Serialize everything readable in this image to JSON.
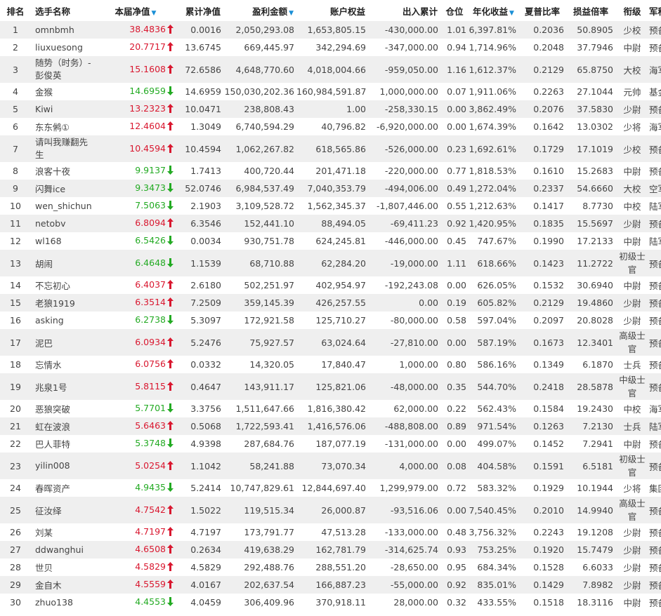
{
  "headers": {
    "rank": "排名",
    "name": "选手名称",
    "nav": "本届净值",
    "cum_nav": "累计净值",
    "pnl": "盈利金额",
    "equity": "账户权益",
    "inout": "出入累计",
    "position": "仓位",
    "annual": "年化收益",
    "sharpe": "夏普比率",
    "loss_ratio": "损益倍率",
    "title": "衔级",
    "branch": "军种"
  },
  "sort_icon": "caret-down-icon",
  "colors": {
    "up": "#d9172f",
    "down": "#22aa22",
    "sort": "#1a8fd6",
    "stripe": "#efefef"
  },
  "rows": [
    {
      "rank": "1",
      "name": "omnbmh",
      "nav": "38.4836",
      "dir": "up",
      "cum": "0.0016",
      "pnl": "2,050,293.08",
      "equity": "1,653,805.15",
      "inout": "-430,000.00",
      "pos": "1.01",
      "annual": "6,397.81%",
      "sharpe": "0.2036",
      "lr": "50.8905",
      "title": "少校",
      "branch": "预备役"
    },
    {
      "rank": "2",
      "name": "liuxuesong",
      "nav": "20.7717",
      "dir": "up",
      "cum": "13.6745",
      "pnl": "669,445.97",
      "equity": "342,294.69",
      "inout": "-347,000.00",
      "pos": "0.94",
      "annual": "1,714.96%",
      "sharpe": "0.2048",
      "lr": "37.7946",
      "title": "中尉",
      "branch": "预备役"
    },
    {
      "rank": "3",
      "name": "随势（时务）- 彭俊英",
      "nav": "15.1608",
      "dir": "up",
      "cum": "72.6586",
      "pnl": "4,648,770.60",
      "equity": "4,018,004.66",
      "inout": "-959,050.00",
      "pos": "1.16",
      "annual": "1,612.37%",
      "sharpe": "0.2129",
      "lr": "65.8750",
      "title": "大校",
      "branch": "海军",
      "tall": true
    },
    {
      "rank": "4",
      "name": "金猴",
      "nav": "14.6959",
      "dir": "down",
      "cum": "14.6959",
      "pnl": "150,030,202.36",
      "equity": "160,984,591.87",
      "inout": "1,000,000.00",
      "pos": "0.07",
      "annual": "1,911.06%",
      "sharpe": "0.2263",
      "lr": "27.1044",
      "title": "元帅",
      "branch": "基金"
    },
    {
      "rank": "5",
      "name": "Kiwi",
      "nav": "13.2323",
      "dir": "up",
      "cum": "10.0471",
      "pnl": "238,808.43",
      "equity": "1.00",
      "inout": "-258,330.15",
      "pos": "0.00",
      "annual": "3,862.49%",
      "sharpe": "0.2076",
      "lr": "37.5830",
      "title": "少尉",
      "branch": "预备役"
    },
    {
      "rank": "6",
      "name": "东东鸺①",
      "nav": "12.4604",
      "dir": "up",
      "cum": "1.3049",
      "pnl": "6,740,594.29",
      "equity": "40,796.82",
      "inout": "-6,920,000.00",
      "pos": "0.00",
      "annual": "1,674.39%",
      "sharpe": "0.1642",
      "lr": "13.0302",
      "title": "少将",
      "branch": "海军"
    },
    {
      "rank": "7",
      "name": "请叫我赚翻先生",
      "nav": "10.4594",
      "dir": "up",
      "cum": "10.4594",
      "pnl": "1,062,267.82",
      "equity": "618,565.86",
      "inout": "-526,000.00",
      "pos": "0.23",
      "annual": "1,692.61%",
      "sharpe": "0.1729",
      "lr": "17.1019",
      "title": "少校",
      "branch": "预备役",
      "tall": true
    },
    {
      "rank": "8",
      "name": "浪客十夜",
      "nav": "9.9137",
      "dir": "down",
      "cum": "1.7413",
      "pnl": "400,720.44",
      "equity": "201,471.18",
      "inout": "-220,000.00",
      "pos": "0.77",
      "annual": "1,818.53%",
      "sharpe": "0.1610",
      "lr": "15.2683",
      "title": "中尉",
      "branch": "预备役"
    },
    {
      "rank": "9",
      "name": "闪舞ice",
      "nav": "9.3473",
      "dir": "down",
      "cum": "52.0746",
      "pnl": "6,984,537.49",
      "equity": "7,040,353.79",
      "inout": "-494,006.00",
      "pos": "0.49",
      "annual": "1,272.04%",
      "sharpe": "0.2337",
      "lr": "54.6660",
      "title": "大校",
      "branch": "空军"
    },
    {
      "rank": "10",
      "name": "wen_shichun",
      "nav": "7.5063",
      "dir": "down",
      "cum": "2.1903",
      "pnl": "3,109,528.72",
      "equity": "1,562,345.37",
      "inout": "-1,807,446.00",
      "pos": "0.55",
      "annual": "1,212.63%",
      "sharpe": "0.1417",
      "lr": "8.7730",
      "title": "中校",
      "branch": "陆军"
    },
    {
      "rank": "11",
      "name": "netobv",
      "nav": "6.8094",
      "dir": "up",
      "cum": "6.3546",
      "pnl": "152,441.10",
      "equity": "88,494.05",
      "inout": "-69,411.23",
      "pos": "0.92",
      "annual": "1,420.95%",
      "sharpe": "0.1835",
      "lr": "15.5697",
      "title": "少尉",
      "branch": "预备役"
    },
    {
      "rank": "12",
      "name": "wl168",
      "nav": "6.5426",
      "dir": "down",
      "cum": "0.0034",
      "pnl": "930,751.78",
      "equity": "624,245.81",
      "inout": "-446,000.00",
      "pos": "0.45",
      "annual": "747.67%",
      "sharpe": "0.1990",
      "lr": "17.2133",
      "title": "中尉",
      "branch": "陆军"
    },
    {
      "rank": "13",
      "name": "胡闹",
      "nav": "6.4648",
      "dir": "down",
      "cum": "1.1539",
      "pnl": "68,710.88",
      "equity": "62,284.20",
      "inout": "-19,000.00",
      "pos": "1.11",
      "annual": "618.66%",
      "sharpe": "0.1423",
      "lr": "11.2722",
      "title": "初级士官",
      "branch": "预备役",
      "tall": true
    },
    {
      "rank": "14",
      "name": "不忘初心",
      "nav": "6.4037",
      "dir": "up",
      "cum": "2.6180",
      "pnl": "502,251.97",
      "equity": "402,954.97",
      "inout": "-192,243.08",
      "pos": "0.00",
      "annual": "626.05%",
      "sharpe": "0.1532",
      "lr": "30.6940",
      "title": "中尉",
      "branch": "预备役"
    },
    {
      "rank": "15",
      "name": "老狼1919",
      "nav": "6.3514",
      "dir": "up",
      "cum": "7.2509",
      "pnl": "359,145.39",
      "equity": "426,257.55",
      "inout": "0.00",
      "pos": "0.19",
      "annual": "605.82%",
      "sharpe": "0.2129",
      "lr": "19.4860",
      "title": "少尉",
      "branch": "预备役"
    },
    {
      "rank": "16",
      "name": "asking",
      "nav": "6.2738",
      "dir": "down",
      "cum": "5.3097",
      "pnl": "172,921.58",
      "equity": "125,710.27",
      "inout": "-80,000.00",
      "pos": "0.58",
      "annual": "597.04%",
      "sharpe": "0.2097",
      "lr": "20.8028",
      "title": "少尉",
      "branch": "预备役"
    },
    {
      "rank": "17",
      "name": "泥巴",
      "nav": "6.0934",
      "dir": "up",
      "cum": "5.2476",
      "pnl": "75,927.57",
      "equity": "63,024.64",
      "inout": "-27,810.00",
      "pos": "0.00",
      "annual": "587.19%",
      "sharpe": "0.1673",
      "lr": "12.3401",
      "title": "高级士官",
      "branch": "预备役",
      "tall": true
    },
    {
      "rank": "18",
      "name": "忘情水",
      "nav": "6.0756",
      "dir": "up",
      "cum": "0.0332",
      "pnl": "14,320.05",
      "equity": "17,840.47",
      "inout": "1,000.00",
      "pos": "0.80",
      "annual": "586.16%",
      "sharpe": "0.1349",
      "lr": "6.1870",
      "title": "士兵",
      "branch": "预备役"
    },
    {
      "rank": "19",
      "name": "兆泉1号",
      "nav": "5.8115",
      "dir": "up",
      "cum": "0.4647",
      "pnl": "143,911.17",
      "equity": "125,821.06",
      "inout": "-48,000.00",
      "pos": "0.35",
      "annual": "544.70%",
      "sharpe": "0.2418",
      "lr": "28.5878",
      "title": "中级士官",
      "branch": "预备役",
      "tall": true
    },
    {
      "rank": "20",
      "name": "恶狼突破",
      "nav": "5.7701",
      "dir": "down",
      "cum": "3.3756",
      "pnl": "1,511,647.66",
      "equity": "1,816,380.42",
      "inout": "62,000.00",
      "pos": "0.22",
      "annual": "562.43%",
      "sharpe": "0.1584",
      "lr": "19.2430",
      "title": "中校",
      "branch": "海军"
    },
    {
      "rank": "21",
      "name": "虹在波浪",
      "nav": "5.6463",
      "dir": "up",
      "cum": "0.5068",
      "pnl": "1,722,593.41",
      "equity": "1,416,576.06",
      "inout": "-488,808.00",
      "pos": "0.89",
      "annual": "971.54%",
      "sharpe": "0.1263",
      "lr": "7.2130",
      "title": "士兵",
      "branch": "陆军"
    },
    {
      "rank": "22",
      "name": "巴人菲特",
      "nav": "5.3748",
      "dir": "down",
      "cum": "4.9398",
      "pnl": "287,684.76",
      "equity": "187,077.19",
      "inout": "-131,000.00",
      "pos": "0.00",
      "annual": "499.07%",
      "sharpe": "0.1452",
      "lr": "7.2941",
      "title": "中尉",
      "branch": "预备役"
    },
    {
      "rank": "23",
      "name": "yilin008",
      "nav": "5.0254",
      "dir": "up",
      "cum": "1.1042",
      "pnl": "58,241.88",
      "equity": "73,070.34",
      "inout": "4,000.00",
      "pos": "0.08",
      "annual": "404.58%",
      "sharpe": "0.1591",
      "lr": "6.5181",
      "title": "初级士官",
      "branch": "预备役",
      "tall": true
    },
    {
      "rank": "24",
      "name": "春晖资产",
      "nav": "4.9435",
      "dir": "down",
      "cum": "5.2414",
      "pnl": "10,747,829.61",
      "equity": "12,844,697.40",
      "inout": "1,299,979.00",
      "pos": "0.72",
      "annual": "583.32%",
      "sharpe": "0.1929",
      "lr": "10.1944",
      "title": "少将",
      "branch": "集团军"
    },
    {
      "rank": "25",
      "name": "征汝绎",
      "nav": "4.7542",
      "dir": "up",
      "cum": "1.5022",
      "pnl": "119,515.34",
      "equity": "26,000.87",
      "inout": "-93,516.06",
      "pos": "0.00",
      "annual": "7,540.45%",
      "sharpe": "0.2010",
      "lr": "14.9940",
      "title": "高级士官",
      "branch": "预备役",
      "tall": true
    },
    {
      "rank": "26",
      "name": "刘某",
      "nav": "4.7197",
      "dir": "up",
      "cum": "4.7197",
      "pnl": "173,791.77",
      "equity": "47,513.28",
      "inout": "-133,000.00",
      "pos": "0.48",
      "annual": "3,756.32%",
      "sharpe": "0.2243",
      "lr": "19.1208",
      "title": "少尉",
      "branch": "预备役"
    },
    {
      "rank": "27",
      "name": "ddwanghui",
      "nav": "4.6508",
      "dir": "up",
      "cum": "0.2634",
      "pnl": "419,638.29",
      "equity": "162,781.79",
      "inout": "-314,625.74",
      "pos": "0.93",
      "annual": "753.25%",
      "sharpe": "0.1920",
      "lr": "15.7479",
      "title": "少尉",
      "branch": "预备役"
    },
    {
      "rank": "28",
      "name": "世贝",
      "nav": "4.5829",
      "dir": "up",
      "cum": "4.5829",
      "pnl": "292,488.76",
      "equity": "288,551.20",
      "inout": "-28,650.00",
      "pos": "0.95",
      "annual": "684.34%",
      "sharpe": "0.1528",
      "lr": "6.6033",
      "title": "少尉",
      "branch": "预备役"
    },
    {
      "rank": "29",
      "name": "金自木",
      "nav": "4.5559",
      "dir": "up",
      "cum": "4.0167",
      "pnl": "202,637.54",
      "equity": "166,887.23",
      "inout": "-55,000.00",
      "pos": "0.92",
      "annual": "835.01%",
      "sharpe": "0.1429",
      "lr": "7.8982",
      "title": "少尉",
      "branch": "预备役"
    },
    {
      "rank": "30",
      "name": "zhuo138",
      "nav": "4.4553",
      "dir": "down",
      "cum": "4.0459",
      "pnl": "306,409.96",
      "equity": "370,918.11",
      "inout": "28,000.00",
      "pos": "0.32",
      "annual": "433.55%",
      "sharpe": "0.1518",
      "lr": "18.3116",
      "title": "中尉",
      "branch": "预备役"
    }
  ]
}
